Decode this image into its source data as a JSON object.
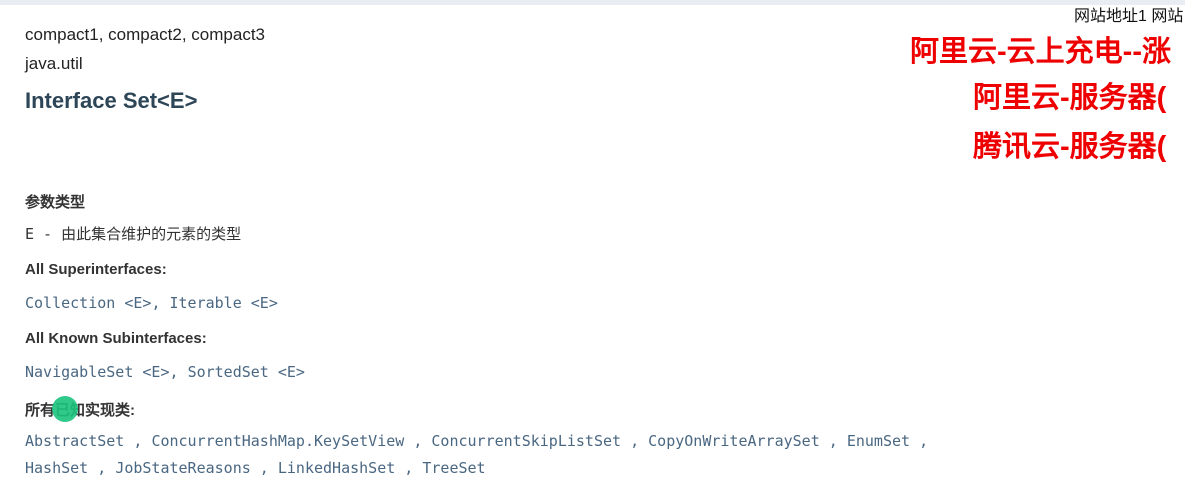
{
  "header": {
    "modules": "compact1, compact2, compact3",
    "package": "java.util",
    "title": "Interface Set<E>"
  },
  "params": {
    "label": "参数类型",
    "name": "E",
    "separator": " - ",
    "description": "由此集合维护的元素的类型"
  },
  "superinterfaces": {
    "label": "All Superinterfaces:",
    "items": [
      "Collection <E>",
      "Iterable <E>"
    ]
  },
  "subinterfaces": {
    "label": "All Known Subinterfaces:",
    "items": [
      "NavigableSet <E>",
      "SortedSet <E>"
    ]
  },
  "implementing": {
    "label": "所有已知实现类:",
    "items": [
      "AbstractSet",
      "ConcurrentHashMap.KeySetView",
      "ConcurrentSkipListSet",
      "CopyOnWriteArraySet",
      "EnumSet",
      "HashSet",
      "JobStateReasons",
      "LinkedHashSet",
      "TreeSet"
    ]
  },
  "ads": {
    "top": "网站地址1 网站",
    "line1": "阿里云-云上充电--涨",
    "line2": "阿里云-服务器(",
    "line3": "腾讯云-服务器("
  },
  "colors": {
    "link": "#4a6782",
    "title": "#2c4557",
    "ad": "#ee0000",
    "cursor": "#19c37d"
  }
}
